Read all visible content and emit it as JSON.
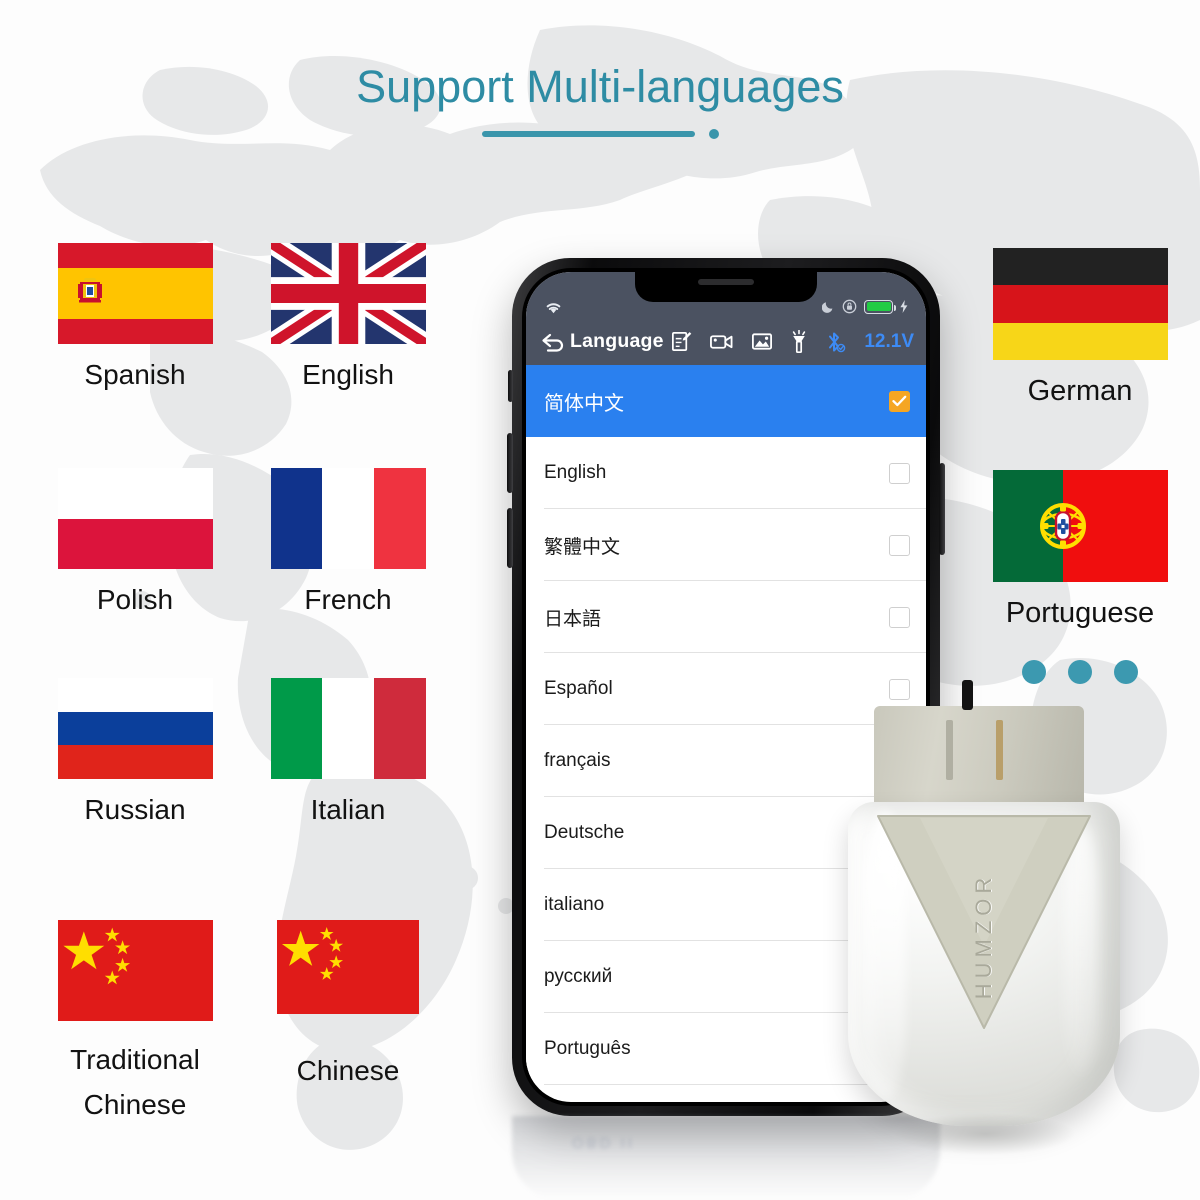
{
  "header": {
    "title": "Support Multi-languages"
  },
  "flags": {
    "left": [
      {
        "code": "es",
        "label": "Spanish",
        "name": "flag-spain"
      },
      {
        "code": "gb",
        "label": "English",
        "name": "flag-united-kingdom"
      },
      {
        "code": "pl",
        "label": "Polish",
        "name": "flag-poland"
      },
      {
        "code": "fr",
        "label": "French",
        "name": "flag-france"
      },
      {
        "code": "ru",
        "label": "Russian",
        "name": "flag-russia"
      },
      {
        "code": "it",
        "label": "Italian",
        "name": "flag-italy"
      },
      {
        "code": "cn",
        "label": "Traditional Chinese",
        "name": "flag-china-traditional"
      },
      {
        "code": "cn",
        "label": "Chinese",
        "name": "flag-china"
      }
    ],
    "right": [
      {
        "code": "de",
        "label": "German",
        "name": "flag-germany"
      },
      {
        "code": "pt",
        "label": "Portuguese",
        "name": "flag-portugal"
      }
    ]
  },
  "phone": {
    "statusbar": {
      "wifi_icon": "wifi-icon",
      "moon_icon": "moon-icon",
      "rotation_lock_icon": "rotation-lock-icon",
      "battery_icon": "battery-icon",
      "charging_icon": "lightning-bolt-icon"
    },
    "appbar": {
      "back_icon": "back-arrow-icon",
      "title": "Language",
      "tools": [
        {
          "name": "note-edit-icon",
          "glyph": "note"
        },
        {
          "name": "video-camera-icon",
          "glyph": "video"
        },
        {
          "name": "screenshot-image-icon",
          "glyph": "image"
        },
        {
          "name": "flashlight-icon",
          "glyph": "flashlight"
        },
        {
          "name": "bluetooth-icon",
          "glyph": "bluetooth"
        }
      ],
      "voltage": "12.1V"
    },
    "language_list": [
      {
        "label": "简体中文",
        "selected": true
      },
      {
        "label": "English",
        "selected": false
      },
      {
        "label": "繁體中文",
        "selected": false
      },
      {
        "label": "日本語",
        "selected": false
      },
      {
        "label": "Español",
        "selected": false
      },
      {
        "label": "français",
        "selected": false
      },
      {
        "label": "Deutsche",
        "selected": false
      },
      {
        "label": "italiano",
        "selected": false
      },
      {
        "label": "русский",
        "selected": false
      },
      {
        "label": "Português",
        "selected": false
      }
    ],
    "reflection_text": "OBD II"
  },
  "device": {
    "brand": "HUMZOR"
  },
  "dots": {
    "count": 3
  },
  "colors": {
    "accent_teal": "#3a95ab",
    "title_teal": "#2e8ca4",
    "selected_row_blue": "#2a80ef",
    "checkbox_orange": "#f5a623",
    "appbar_grey": "#4b5261",
    "voltage_blue": "#3d8bf5",
    "battery_green": "#22cc44"
  }
}
